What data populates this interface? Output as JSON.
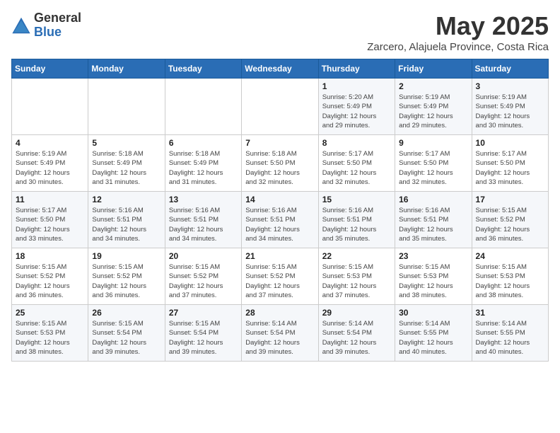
{
  "logo": {
    "general": "General",
    "blue": "Blue"
  },
  "title": "May 2025",
  "subtitle": "Zarcero, Alajuela Province, Costa Rica",
  "days_of_week": [
    "Sunday",
    "Monday",
    "Tuesday",
    "Wednesday",
    "Thursday",
    "Friday",
    "Saturday"
  ],
  "weeks": [
    [
      {
        "day": "",
        "content": ""
      },
      {
        "day": "",
        "content": ""
      },
      {
        "day": "",
        "content": ""
      },
      {
        "day": "",
        "content": ""
      },
      {
        "day": "1",
        "content": "Sunrise: 5:20 AM\nSunset: 5:49 PM\nDaylight: 12 hours\nand 29 minutes."
      },
      {
        "day": "2",
        "content": "Sunrise: 5:19 AM\nSunset: 5:49 PM\nDaylight: 12 hours\nand 29 minutes."
      },
      {
        "day": "3",
        "content": "Sunrise: 5:19 AM\nSunset: 5:49 PM\nDaylight: 12 hours\nand 30 minutes."
      }
    ],
    [
      {
        "day": "4",
        "content": "Sunrise: 5:19 AM\nSunset: 5:49 PM\nDaylight: 12 hours\nand 30 minutes."
      },
      {
        "day": "5",
        "content": "Sunrise: 5:18 AM\nSunset: 5:49 PM\nDaylight: 12 hours\nand 31 minutes."
      },
      {
        "day": "6",
        "content": "Sunrise: 5:18 AM\nSunset: 5:49 PM\nDaylight: 12 hours\nand 31 minutes."
      },
      {
        "day": "7",
        "content": "Sunrise: 5:18 AM\nSunset: 5:50 PM\nDaylight: 12 hours\nand 32 minutes."
      },
      {
        "day": "8",
        "content": "Sunrise: 5:17 AM\nSunset: 5:50 PM\nDaylight: 12 hours\nand 32 minutes."
      },
      {
        "day": "9",
        "content": "Sunrise: 5:17 AM\nSunset: 5:50 PM\nDaylight: 12 hours\nand 32 minutes."
      },
      {
        "day": "10",
        "content": "Sunrise: 5:17 AM\nSunset: 5:50 PM\nDaylight: 12 hours\nand 33 minutes."
      }
    ],
    [
      {
        "day": "11",
        "content": "Sunrise: 5:17 AM\nSunset: 5:50 PM\nDaylight: 12 hours\nand 33 minutes."
      },
      {
        "day": "12",
        "content": "Sunrise: 5:16 AM\nSunset: 5:51 PM\nDaylight: 12 hours\nand 34 minutes."
      },
      {
        "day": "13",
        "content": "Sunrise: 5:16 AM\nSunset: 5:51 PM\nDaylight: 12 hours\nand 34 minutes."
      },
      {
        "day": "14",
        "content": "Sunrise: 5:16 AM\nSunset: 5:51 PM\nDaylight: 12 hours\nand 34 minutes."
      },
      {
        "day": "15",
        "content": "Sunrise: 5:16 AM\nSunset: 5:51 PM\nDaylight: 12 hours\nand 35 minutes."
      },
      {
        "day": "16",
        "content": "Sunrise: 5:16 AM\nSunset: 5:51 PM\nDaylight: 12 hours\nand 35 minutes."
      },
      {
        "day": "17",
        "content": "Sunrise: 5:15 AM\nSunset: 5:52 PM\nDaylight: 12 hours\nand 36 minutes."
      }
    ],
    [
      {
        "day": "18",
        "content": "Sunrise: 5:15 AM\nSunset: 5:52 PM\nDaylight: 12 hours\nand 36 minutes."
      },
      {
        "day": "19",
        "content": "Sunrise: 5:15 AM\nSunset: 5:52 PM\nDaylight: 12 hours\nand 36 minutes."
      },
      {
        "day": "20",
        "content": "Sunrise: 5:15 AM\nSunset: 5:52 PM\nDaylight: 12 hours\nand 37 minutes."
      },
      {
        "day": "21",
        "content": "Sunrise: 5:15 AM\nSunset: 5:52 PM\nDaylight: 12 hours\nand 37 minutes."
      },
      {
        "day": "22",
        "content": "Sunrise: 5:15 AM\nSunset: 5:53 PM\nDaylight: 12 hours\nand 37 minutes."
      },
      {
        "day": "23",
        "content": "Sunrise: 5:15 AM\nSunset: 5:53 PM\nDaylight: 12 hours\nand 38 minutes."
      },
      {
        "day": "24",
        "content": "Sunrise: 5:15 AM\nSunset: 5:53 PM\nDaylight: 12 hours\nand 38 minutes."
      }
    ],
    [
      {
        "day": "25",
        "content": "Sunrise: 5:15 AM\nSunset: 5:53 PM\nDaylight: 12 hours\nand 38 minutes."
      },
      {
        "day": "26",
        "content": "Sunrise: 5:15 AM\nSunset: 5:54 PM\nDaylight: 12 hours\nand 39 minutes."
      },
      {
        "day": "27",
        "content": "Sunrise: 5:15 AM\nSunset: 5:54 PM\nDaylight: 12 hours\nand 39 minutes."
      },
      {
        "day": "28",
        "content": "Sunrise: 5:14 AM\nSunset: 5:54 PM\nDaylight: 12 hours\nand 39 minutes."
      },
      {
        "day": "29",
        "content": "Sunrise: 5:14 AM\nSunset: 5:54 PM\nDaylight: 12 hours\nand 39 minutes."
      },
      {
        "day": "30",
        "content": "Sunrise: 5:14 AM\nSunset: 5:55 PM\nDaylight: 12 hours\nand 40 minutes."
      },
      {
        "day": "31",
        "content": "Sunrise: 5:14 AM\nSunset: 5:55 PM\nDaylight: 12 hours\nand 40 minutes."
      }
    ]
  ]
}
